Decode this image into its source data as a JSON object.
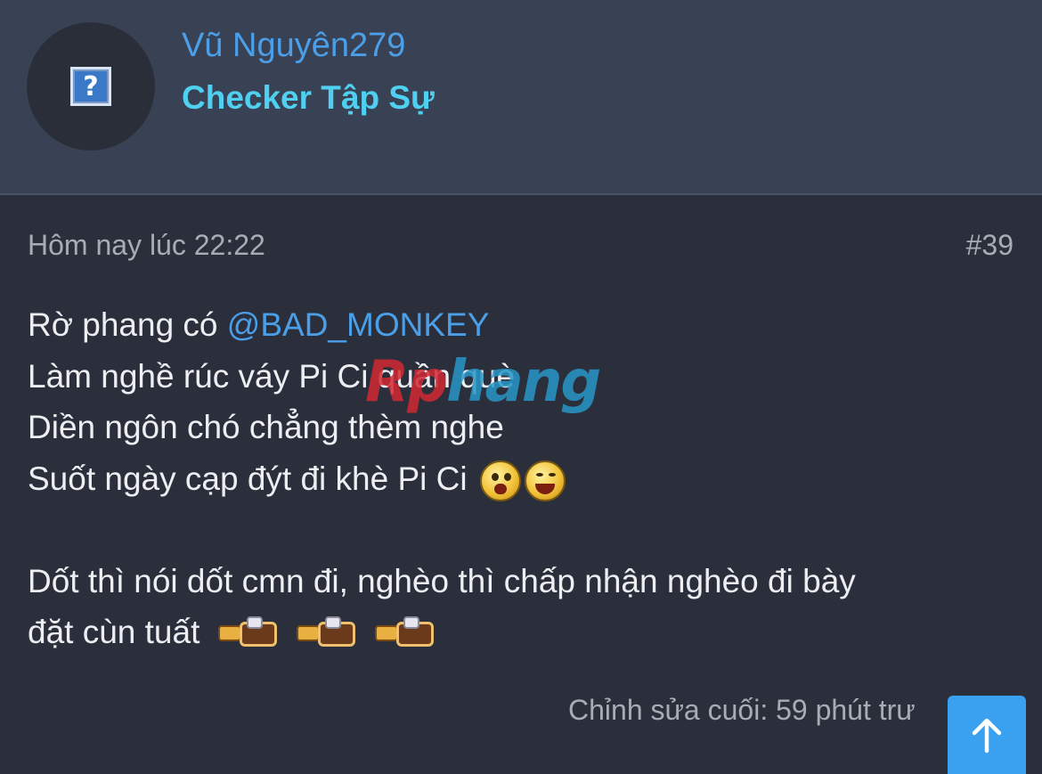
{
  "user": {
    "name": "Vũ Nguyên279",
    "title": "Checker Tập Sự",
    "avatar_icon": "unknown-avatar-icon"
  },
  "post": {
    "timestamp": "Hôm nay lúc 22:22",
    "number": "#39",
    "lines": {
      "l1_text": "Rờ phang có ",
      "l1_mention": "@BAD_MONKEY",
      "l2": "Làm nghề rúc váy Pi Ci quần què",
      "l3": "Diền ngôn chó chẳng thèm nghe",
      "l4": "Suốt ngày cạp đýt đi khè Pi Ci",
      "l5": "Dốt thì nói dốt cmn đi, nghèo thì chấp nhận nghèo đi bày",
      "l6": "đặt cùn tuất"
    },
    "edited": "Chỉnh sửa cuối: 59 phút trư"
  },
  "watermark": {
    "part1": "Rp",
    "part2": "hang"
  },
  "scroll_top_icon": "arrow-up-icon",
  "colors": {
    "background": "#2b2f3b",
    "header": "#394255",
    "username": "#4a9fe8",
    "usertitle": "#4fd0f0",
    "mention": "#4a9fe8",
    "scroll_button": "#3aa0f0"
  }
}
